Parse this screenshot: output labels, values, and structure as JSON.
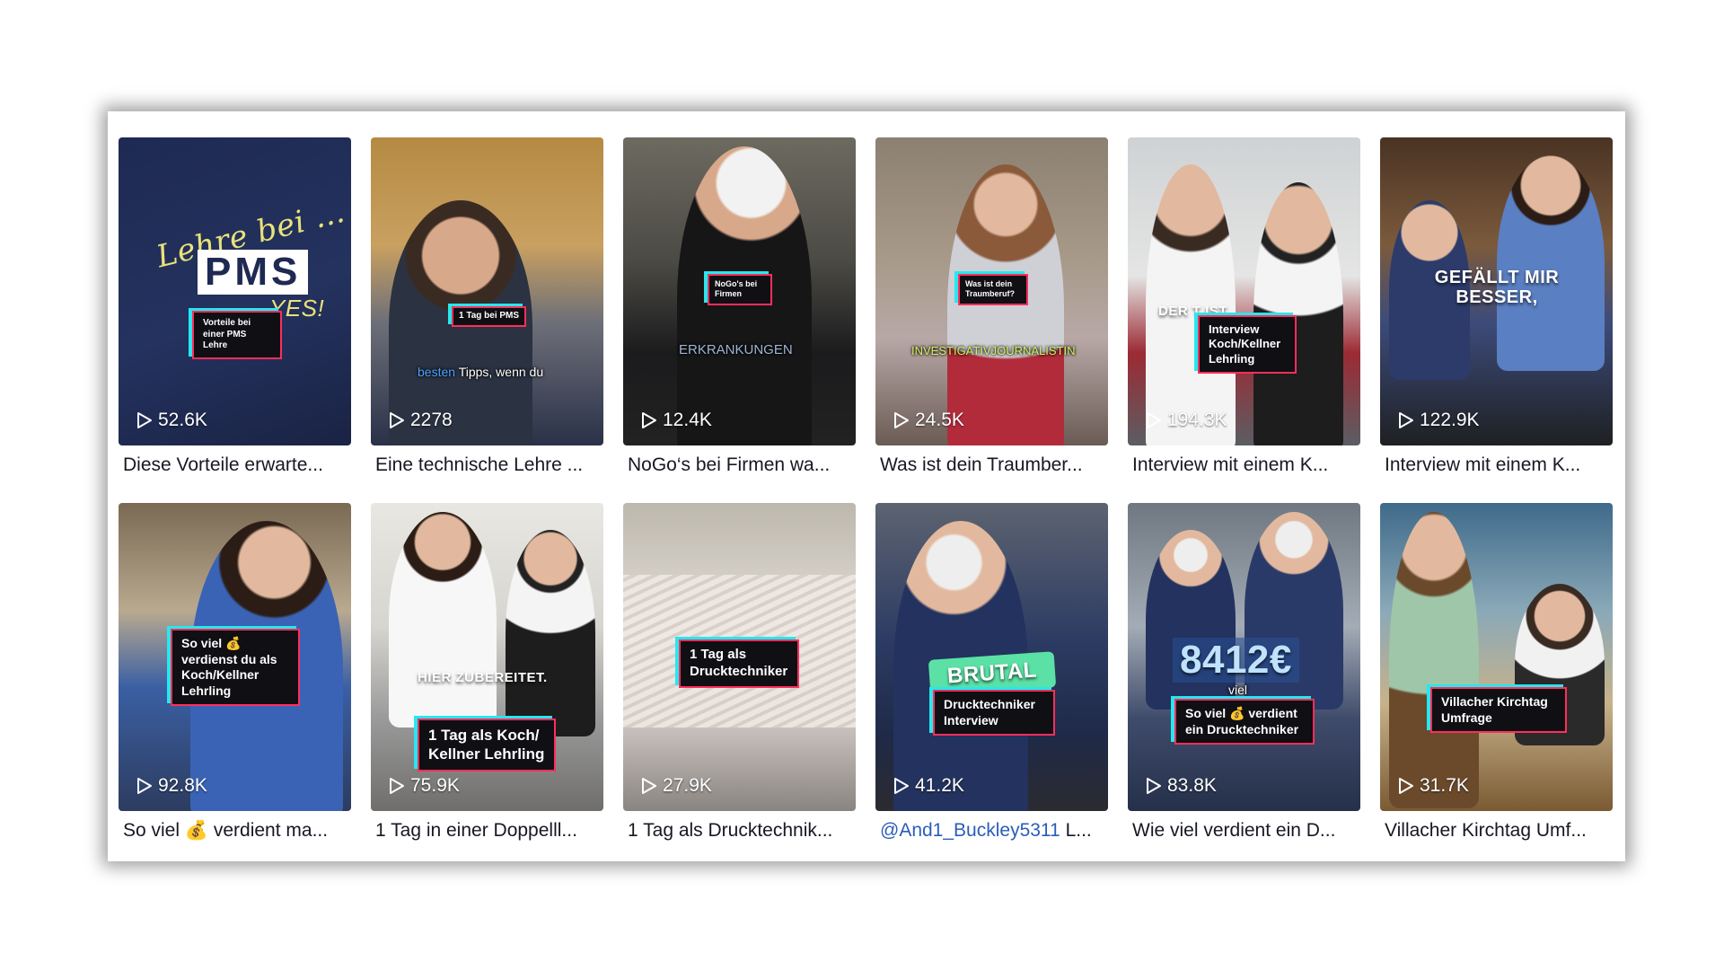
{
  "colors": {
    "caption_text": "#161823",
    "mention": "#2b5db9",
    "label_border": "#ff2e5b",
    "label_shadow": "#25e8f0"
  },
  "icons": {
    "views": "play-icon"
  },
  "videos": [
    {
      "views": "52.6K",
      "caption": "Diese Vorteile erwarte...",
      "overlay": "Vorteile bei einer PMS Lehre",
      "scene_text": [
        "Lehre bei ...",
        "PMS",
        "YES!"
      ]
    },
    {
      "views": "2278",
      "caption": "Eine technische Lehre ...",
      "overlay": "1 Tag bei PMS",
      "subtitle_highlight": "besten",
      "subtitle": "Tipps, wenn du"
    },
    {
      "views": "12.4K",
      "caption": "NoGo‘s bei Firmen wa...",
      "overlay": "NoGo's bei Firmen",
      "subtitle": "ERKRANKUNGEN"
    },
    {
      "views": "24.5K",
      "caption": "Was ist dein Traumber...",
      "overlay": "Was ist dein Traumberuf?",
      "subtitle": "INVESTIGATIVJOURNALISTIN"
    },
    {
      "views": "194.3K",
      "caption": "Interview mit einem K...",
      "overlay": "Interview Koch/Kellner Lehrling",
      "big_text": "DER T IST."
    },
    {
      "views": "122.9K",
      "caption": "Interview mit einem K...",
      "big_text": "GEFÄLLT MIR BESSER,"
    },
    {
      "views": "92.8K",
      "caption": "So viel 💰 verdient ma...",
      "overlay": "So viel 💰 verdienst du als Koch/Kellner Lehrling"
    },
    {
      "views": "75.9K",
      "caption": "1 Tag in einer Doppelll...",
      "overlay": "1 Tag als Koch/ Kellner Lehrling",
      "big_text": "HIER ZUBEREITET."
    },
    {
      "views": "27.9K",
      "caption": "1 Tag als Drucktechnik...",
      "overlay": "1 Tag als Drucktechniker"
    },
    {
      "views": "41.2K",
      "caption_mention": "@And1_Buckley5311",
      "caption": " L...",
      "overlay": "Drucktechniker Interview",
      "big_text": "BRUTAL"
    },
    {
      "views": "83.8K",
      "caption": "Wie viel verdient ein D...",
      "overlay": "So viel 💰 verdient ein Drucktechniker",
      "big_text": "8412€",
      "subtitle": "viel"
    },
    {
      "views": "31.7K",
      "caption": "Villacher Kirchtag Umf...",
      "overlay": "Villacher Kirchtag Umfrage"
    }
  ]
}
